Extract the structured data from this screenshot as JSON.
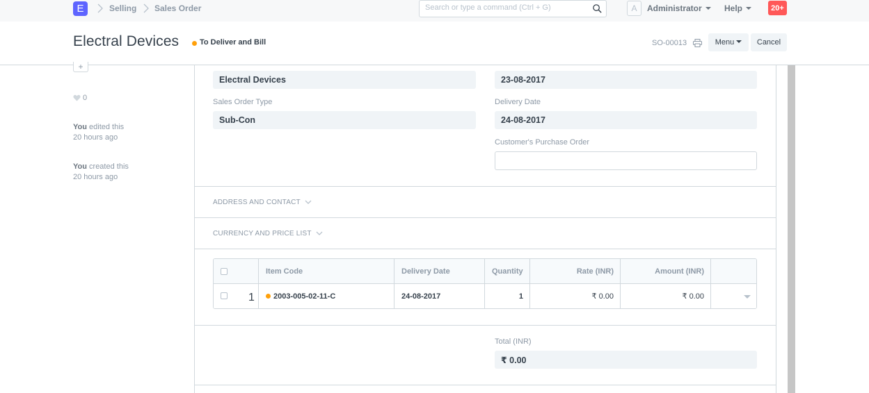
{
  "navbar": {
    "logo_letter": "E",
    "breadcrumbs": [
      "Selling",
      "Sales Order"
    ],
    "search_placeholder": "Search or type a command (Ctrl + G)",
    "avatar_letter": "A",
    "user": "Administrator",
    "help": "Help",
    "notifications": "20+"
  },
  "page": {
    "title": "Electral Devices",
    "status": "To Deliver and Bill",
    "status_color": "#ffa00a",
    "doc_name": "SO-00013",
    "menu_button": "Menu",
    "cancel_button": "Cancel"
  },
  "sidebar": {
    "add_symbol": "+",
    "likes": "0",
    "activity": [
      {
        "who": "You",
        "action": " edited this",
        "when": "20 hours ago"
      },
      {
        "who": "You",
        "action": " created this",
        "when": "20 hours ago"
      }
    ]
  },
  "form": {
    "customer_name": "Electral Devices",
    "date": "23-08-2017",
    "order_type_label": "Sales Order Type",
    "order_type": "Sub-Con",
    "delivery_date_label": "Delivery Date",
    "delivery_date": "24-08-2017",
    "po_label": "Customer's Purchase Order",
    "po_value": "",
    "sections": [
      "ADDRESS AND CONTACT",
      "CURRENCY AND PRICE LIST"
    ],
    "total_label": "Total (INR)",
    "total_value": "₹ 0.00"
  },
  "items": {
    "columns": [
      "Item Code",
      "Delivery Date",
      "Quantity",
      "Rate (INR)",
      "Amount (INR)"
    ],
    "rows": [
      {
        "idx": "1",
        "item_code": "2003-005-02-11-C",
        "delivery_date": "24-08-2017",
        "qty": "1",
        "rate": "₹ 0.00",
        "amount": "₹ 0.00"
      }
    ]
  },
  "colors": {
    "brand": "#5e64ff",
    "badge": "#ff5858",
    "status": "#ffa00a"
  },
  "icons": [
    "search-icon",
    "print-icon",
    "heart-icon",
    "chevron-down-icon",
    "chevron-right-icon"
  ]
}
